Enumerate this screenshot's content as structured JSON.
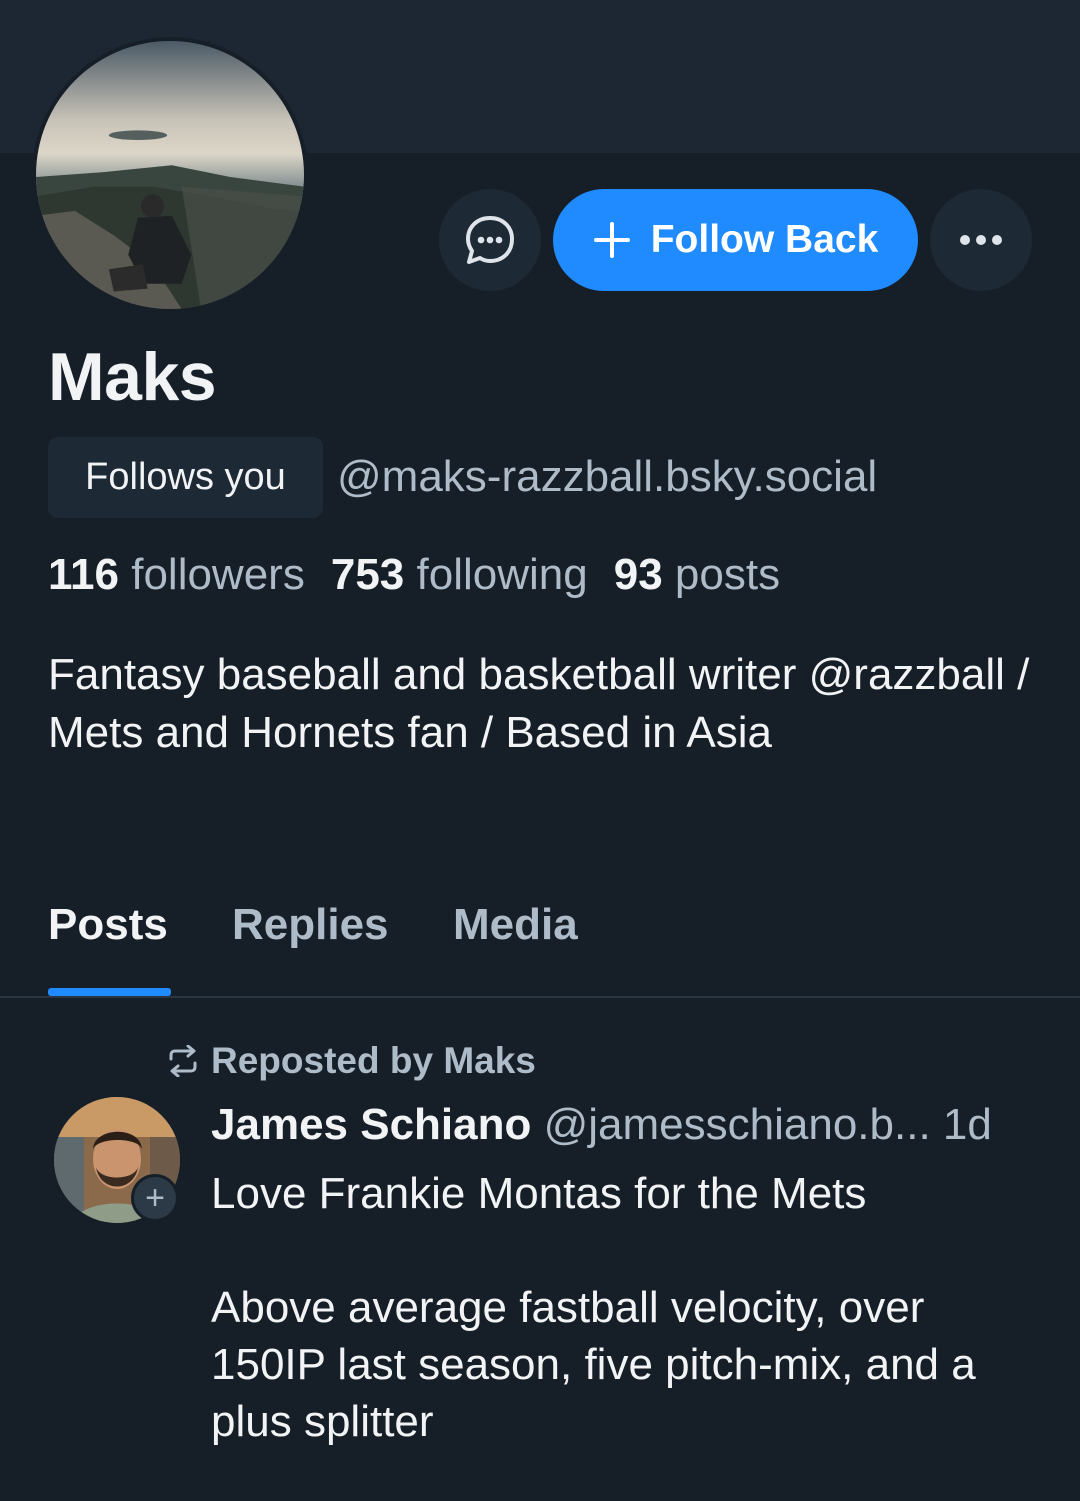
{
  "profile": {
    "display_name": "Maks",
    "follows_you_label": "Follows you",
    "handle": "@maks-razzball.bsky.social",
    "bio": "Fantasy baseball and basketball writer @razzball / Mets and Hornets fan / Based in Asia",
    "avatar_icon": "profile-photo"
  },
  "stats": {
    "followers_count": "116",
    "followers_label": "followers",
    "following_count": "753",
    "following_label": "following",
    "posts_count": "93",
    "posts_label": "posts"
  },
  "actions": {
    "message_icon": "chat-bubble-icon",
    "follow_label": "Follow Back",
    "follow_icon": "plus-icon",
    "more_icon": "ellipsis-icon"
  },
  "tabs": [
    {
      "label": "Posts",
      "active": true
    },
    {
      "label": "Replies",
      "active": false
    },
    {
      "label": "Media",
      "active": false
    }
  ],
  "feed": {
    "repost_label": "Reposted by Maks",
    "post": {
      "author_name": "James Schiano",
      "author_handle": "@jamesschiano.b...",
      "time": "1d",
      "text": "Love Frankie Montas for the Mets\n\nAbove average fastball velocity, over 150IP last season, five pitch-mix, and a plus splitter"
    }
  },
  "colors": {
    "background": "#161e27",
    "banner": "#1d2733",
    "accent": "#208bfe",
    "muted_text": "#aebbc9",
    "primary_text": "#f1f3f5"
  }
}
